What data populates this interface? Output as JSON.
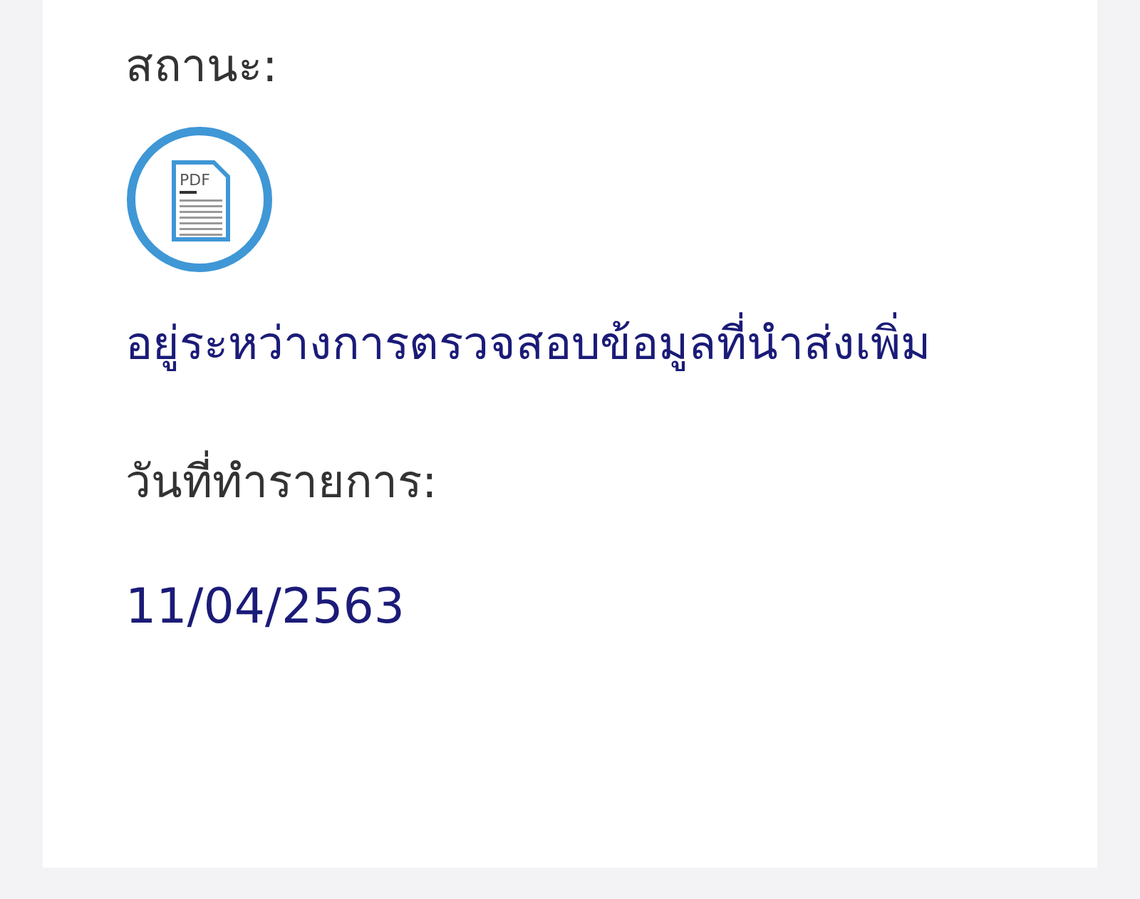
{
  "status": {
    "label": "สถานะ:",
    "icon_text": "PDF",
    "value": "อยู่ระหว่างการตรวจสอบข้อมูลที่นำส่งเพิ่ม"
  },
  "date": {
    "label": "วันที่ทำรายการ:",
    "value": "11/04/2563"
  }
}
